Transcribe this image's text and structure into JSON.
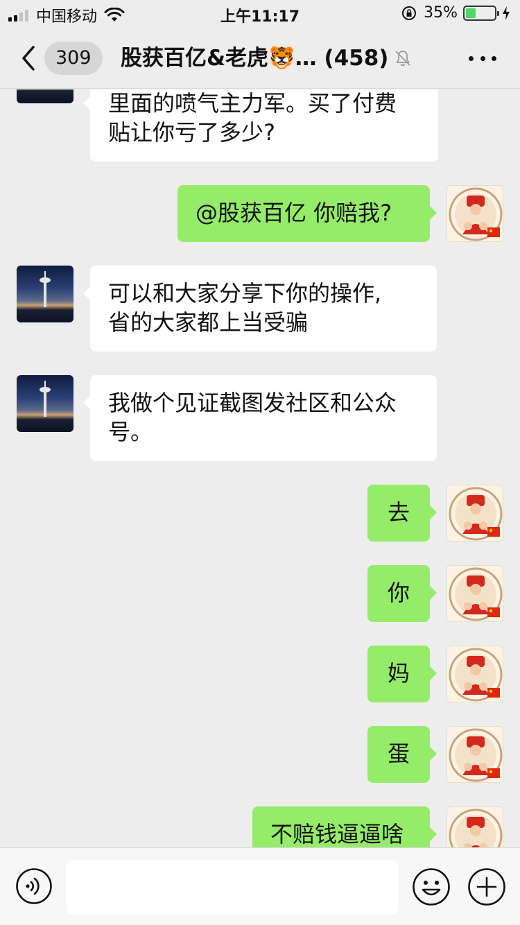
{
  "status_bar": {
    "carrier": "中国移动",
    "time": "上午11:17",
    "battery_percent": "35%",
    "battery_level": 0.35,
    "battery_color": "#4cd964"
  },
  "nav": {
    "back_icon": "chevron-left-icon",
    "unread_count": "309",
    "title": "股获百亿&老虎🐯… (458)",
    "mute_icon": "bell-slash-icon",
    "more_icon": "ellipsis-icon"
  },
  "messages": [
    {
      "side": "left",
      "text": "里面的喷气主力军。买了付费\n贴让你亏了多少?"
    },
    {
      "side": "right",
      "text": "@股获百亿 你赔我?"
    },
    {
      "side": "left",
      "text": "可以和大家分享下你的操作,\n省的大家都上当受骗"
    },
    {
      "side": "left",
      "text": "我做个见证截图发社区和公众\n号。"
    },
    {
      "side": "right",
      "text": "去"
    },
    {
      "side": "right",
      "text": "你"
    },
    {
      "side": "right",
      "text": "妈"
    },
    {
      "side": "right",
      "text": "蛋"
    },
    {
      "side": "right",
      "text": "不赔钱逼逼啥"
    }
  ],
  "input_bar": {
    "voice_icon": "voice-icon",
    "emoji_icon": "emoji-icon",
    "plus_icon": "plus-icon",
    "placeholder": ""
  },
  "colors": {
    "background": "#ededed",
    "outgoing_bubble": "#95ec69",
    "incoming_bubble": "#ffffff"
  }
}
